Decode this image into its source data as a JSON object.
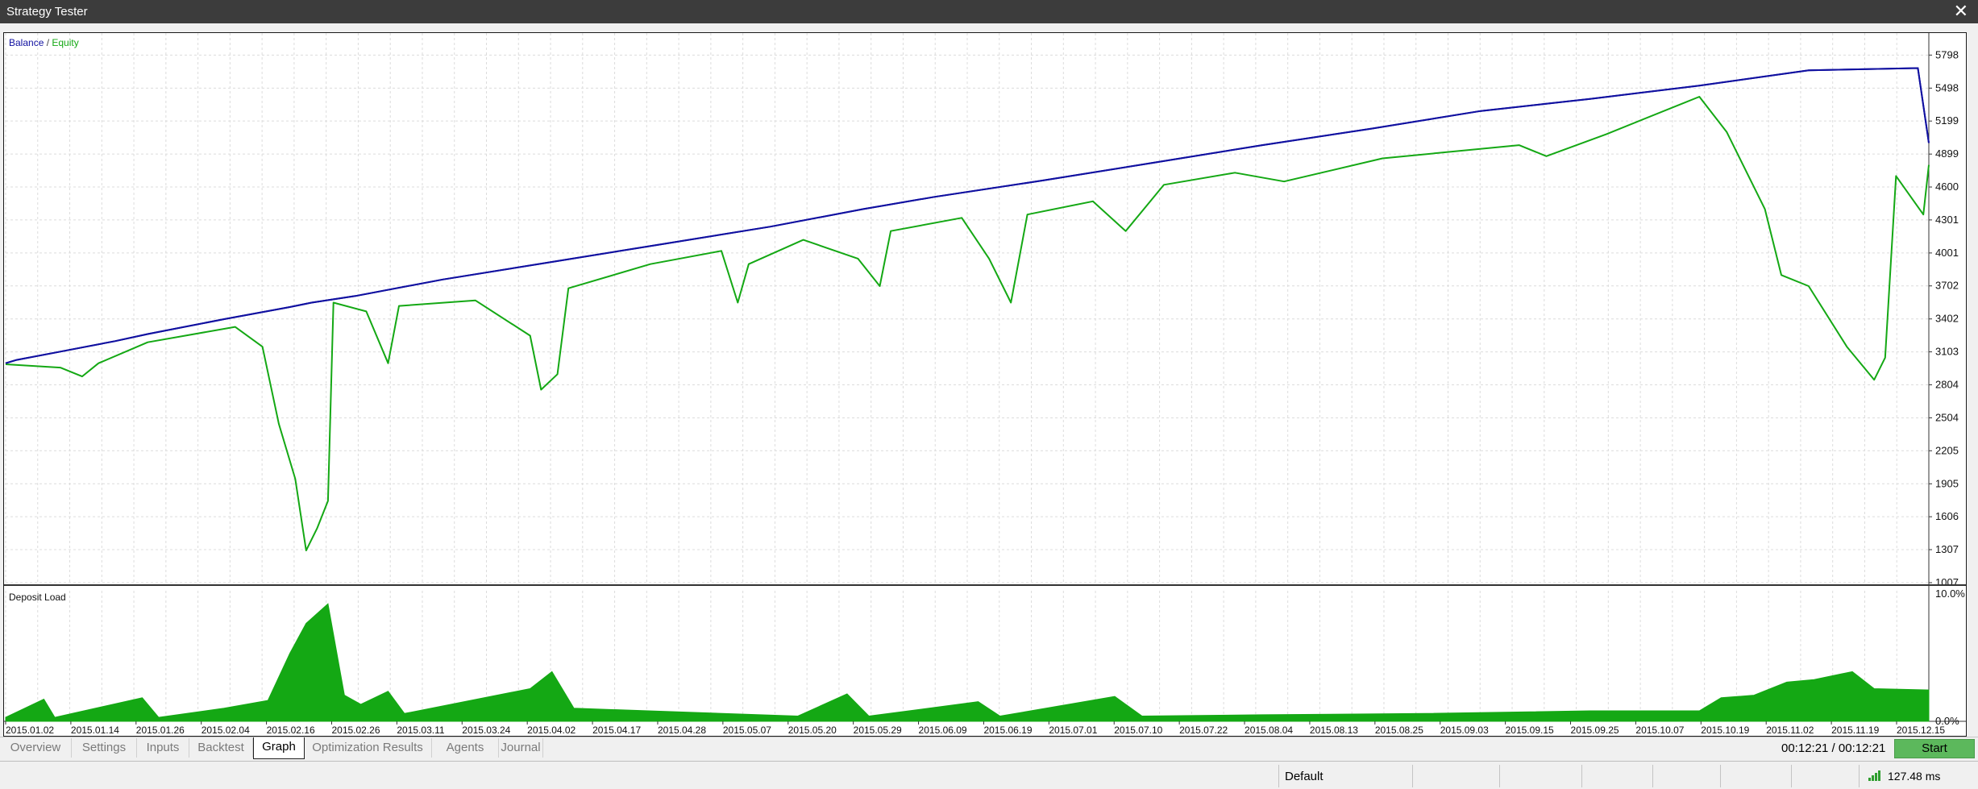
{
  "window": {
    "title": "Strategy Tester",
    "close_icon": "close-icon"
  },
  "legend": {
    "balance": "Balance",
    "separator": "/",
    "equity": "Equity"
  },
  "colors": {
    "balance": "#1010a0",
    "equity": "#14a814",
    "deposit_load": "#14a814",
    "start": "#5cb85c"
  },
  "chart_data": [
    {
      "type": "line",
      "title": "",
      "legend": [
        "Balance",
        "Equity"
      ],
      "ylim": [
        1007,
        5998
      ],
      "y_ticks": [
        5798,
        5498,
        5199,
        4899,
        4600,
        4301,
        4001,
        3702,
        3402,
        3103,
        2804,
        2504,
        2205,
        1905,
        1606,
        1307,
        1007
      ],
      "grid": true,
      "series": [
        {
          "name": "Balance",
          "color": "#1010a0",
          "points": [
            [
              0,
              3000
            ],
            [
              2,
              3030
            ],
            [
              10,
              3105
            ],
            [
              20,
              3200
            ],
            [
              26,
              3265
            ],
            [
              40,
              3400
            ],
            [
              52,
              3510
            ],
            [
              56,
              3550
            ],
            [
              64,
              3610
            ],
            [
              80,
              3760
            ],
            [
              100,
              3920
            ],
            [
              120,
              4080
            ],
            [
              140,
              4240
            ],
            [
              157,
              4400
            ],
            [
              170,
              4510
            ],
            [
              190,
              4660
            ],
            [
              210,
              4820
            ],
            [
              230,
              4980
            ],
            [
              250,
              5130
            ],
            [
              270,
              5290
            ],
            [
              290,
              5400
            ],
            [
              310,
              5520
            ],
            [
              330,
              5660
            ],
            [
              350,
              5680
            ],
            [
              352,
              5000
            ]
          ]
        },
        {
          "name": "Equity",
          "color": "#14a814",
          "points": [
            [
              0,
              2990
            ],
            [
              10,
              2960
            ],
            [
              14,
              2880
            ],
            [
              17,
              3000
            ],
            [
              26,
              3190
            ],
            [
              42,
              3330
            ],
            [
              47,
              3150
            ],
            [
              50,
              2450
            ],
            [
              53,
              1950
            ],
            [
              55,
              1300
            ],
            [
              57,
              1500
            ],
            [
              59,
              1750
            ],
            [
              60,
              3550
            ],
            [
              66,
              3470
            ],
            [
              70,
              3000
            ],
            [
              72,
              3520
            ],
            [
              86,
              3570
            ],
            [
              96,
              3250
            ],
            [
              98,
              2760
            ],
            [
              101,
              2900
            ],
            [
              103,
              3680
            ],
            [
              118,
              3900
            ],
            [
              131,
              4020
            ],
            [
              134,
              3550
            ],
            [
              136,
              3900
            ],
            [
              146,
              4120
            ],
            [
              156,
              3950
            ],
            [
              160,
              3700
            ],
            [
              162,
              4200
            ],
            [
              175,
              4320
            ],
            [
              180,
              3950
            ],
            [
              184,
              3550
            ],
            [
              187,
              4350
            ],
            [
              199,
              4470
            ],
            [
              205,
              4200
            ],
            [
              212,
              4620
            ],
            [
              225,
              4730
            ],
            [
              234,
              4650
            ],
            [
              252,
              4860
            ],
            [
              277,
              4980
            ],
            [
              282,
              4880
            ],
            [
              293,
              5080
            ],
            [
              310,
              5420
            ],
            [
              315,
              5100
            ],
            [
              322,
              4400
            ],
            [
              325,
              3800
            ],
            [
              330,
              3700
            ],
            [
              337,
              3150
            ],
            [
              342,
              2850
            ],
            [
              344,
              3050
            ],
            [
              346,
              4700
            ],
            [
              351,
              4350
            ],
            [
              352,
              4800
            ]
          ]
        }
      ]
    },
    {
      "type": "area",
      "title": "Deposit Load",
      "ylim": [
        0,
        10
      ],
      "y_ticks_labels": [
        "10.0%",
        "0.0%"
      ],
      "x_ticks": [
        "2015.01.02",
        "2015.01.14",
        "2015.01.26",
        "2015.02.04",
        "2015.02.16",
        "2015.02.26",
        "2015.03.11",
        "2015.03.24",
        "2015.04.02",
        "2015.04.17",
        "2015.04.28",
        "2015.05.07",
        "2015.05.20",
        "2015.05.29",
        "2015.06.09",
        "2015.06.19",
        "2015.07.01",
        "2015.07.10",
        "2015.07.22",
        "2015.08.04",
        "2015.08.13",
        "2015.08.25",
        "2015.09.03",
        "2015.09.15",
        "2015.09.25",
        "2015.10.07",
        "2015.10.19",
        "2015.11.02",
        "2015.11.19",
        "2015.12.15"
      ],
      "series": [
        {
          "name": "Deposit Load",
          "color": "#14a814",
          "points": [
            [
              0,
              0.3
            ],
            [
              7,
              1.7
            ],
            [
              9,
              0.3
            ],
            [
              25,
              1.8
            ],
            [
              28,
              0.3
            ],
            [
              40,
              1.0
            ],
            [
              48,
              1.6
            ],
            [
              52,
              5.2
            ],
            [
              55,
              7.5
            ],
            [
              59,
              9.0
            ],
            [
              62,
              2.0
            ],
            [
              65,
              1.3
            ],
            [
              70,
              2.3
            ],
            [
              73,
              0.6
            ],
            [
              96,
              2.5
            ],
            [
              100,
              3.8
            ],
            [
              104,
              1.0
            ],
            [
              145,
              0.4
            ],
            [
              154,
              2.1
            ],
            [
              158,
              0.4
            ],
            [
              178,
              1.5
            ],
            [
              182,
              0.4
            ],
            [
              203,
              1.9
            ],
            [
              208,
              0.4
            ],
            [
              230,
              0.5
            ],
            [
              260,
              0.6
            ],
            [
              290,
              0.8
            ],
            [
              310,
              0.8
            ],
            [
              314,
              1.8
            ],
            [
              320,
              2.0
            ],
            [
              326,
              3.0
            ],
            [
              331,
              3.2
            ],
            [
              338,
              3.8
            ],
            [
              342,
              2.5
            ],
            [
              352,
              2.4
            ]
          ]
        }
      ]
    }
  ],
  "tabs": [
    {
      "label": "Overview"
    },
    {
      "label": "Settings"
    },
    {
      "label": "Inputs"
    },
    {
      "label": "Backtest"
    },
    {
      "label": "Graph"
    },
    {
      "label": "Optimization Results"
    },
    {
      "label": "Agents"
    },
    {
      "label": "Journal"
    }
  ],
  "timer": "00:12:21 / 00:12:21",
  "start_label": "Start",
  "status": {
    "profile": "Default",
    "ping": "127.48 ms",
    "signal_icon": "signal-icon"
  }
}
